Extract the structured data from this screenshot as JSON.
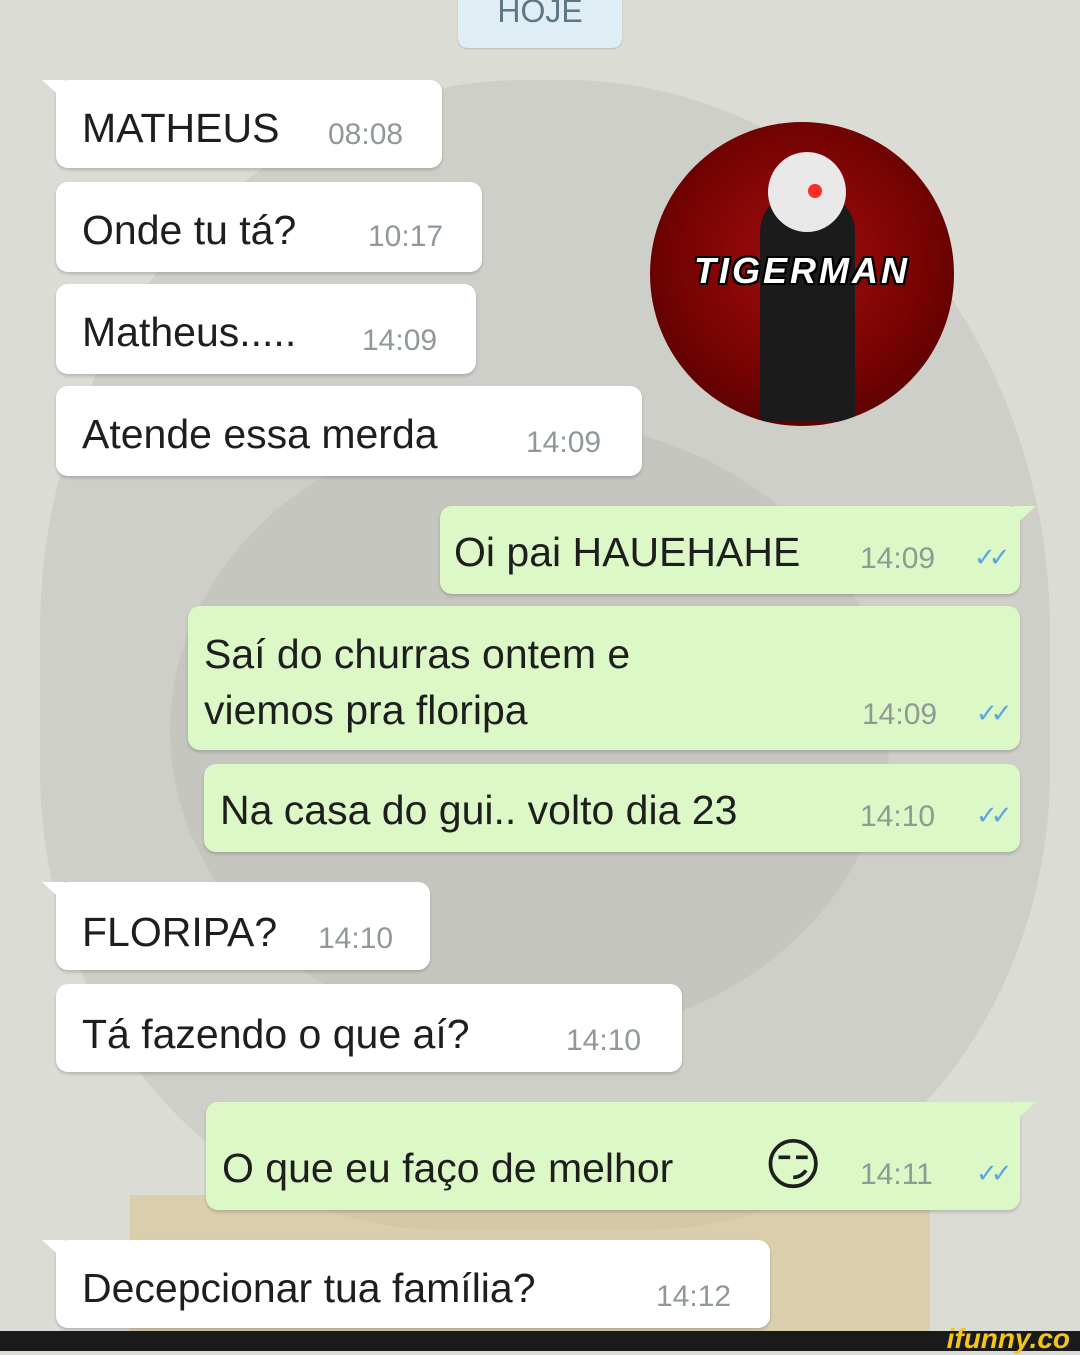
{
  "date_divider": "HOJE",
  "messages": [
    {
      "text": "MATHEUS",
      "time": "08:08",
      "dir": "in"
    },
    {
      "text": "Onde tu tá?",
      "time": "10:17",
      "dir": "in"
    },
    {
      "text": "Matheus.....",
      "time": "14:09",
      "dir": "in"
    },
    {
      "text": "Atende essa merda",
      "time": "14:09",
      "dir": "in"
    },
    {
      "text": "Oi pai HAUEHAHE",
      "time": "14:09",
      "dir": "out",
      "ticks": "✓✓"
    },
    {
      "line1": "Saí do churras ontem e",
      "line2": "viemos pra floripa",
      "time": "14:09",
      "dir": "out",
      "ticks": "✓✓"
    },
    {
      "text": "Na casa do gui.. volto dia 23",
      "time": "14:10",
      "dir": "out",
      "ticks": "✓✓"
    },
    {
      "text": "FLORIPA?",
      "time": "14:10",
      "dir": "in"
    },
    {
      "text": "Tá fazendo o que aí?",
      "time": "14:10",
      "dir": "in"
    },
    {
      "text": "O que eu faço de melhor",
      "emoji": "😏",
      "time": "14:11",
      "dir": "out",
      "ticks": "✓✓"
    },
    {
      "text": "Decepcionar tua família?",
      "time": "14:12",
      "dir": "in"
    }
  ],
  "logo": {
    "text": "TIGERMAN"
  },
  "watermark": "ifunny.co",
  "colors": {
    "incoming": "#ffffff",
    "outgoing": "#dcf8c6",
    "read_ticks": "#5aa7e0",
    "time": "#8e9a93"
  }
}
